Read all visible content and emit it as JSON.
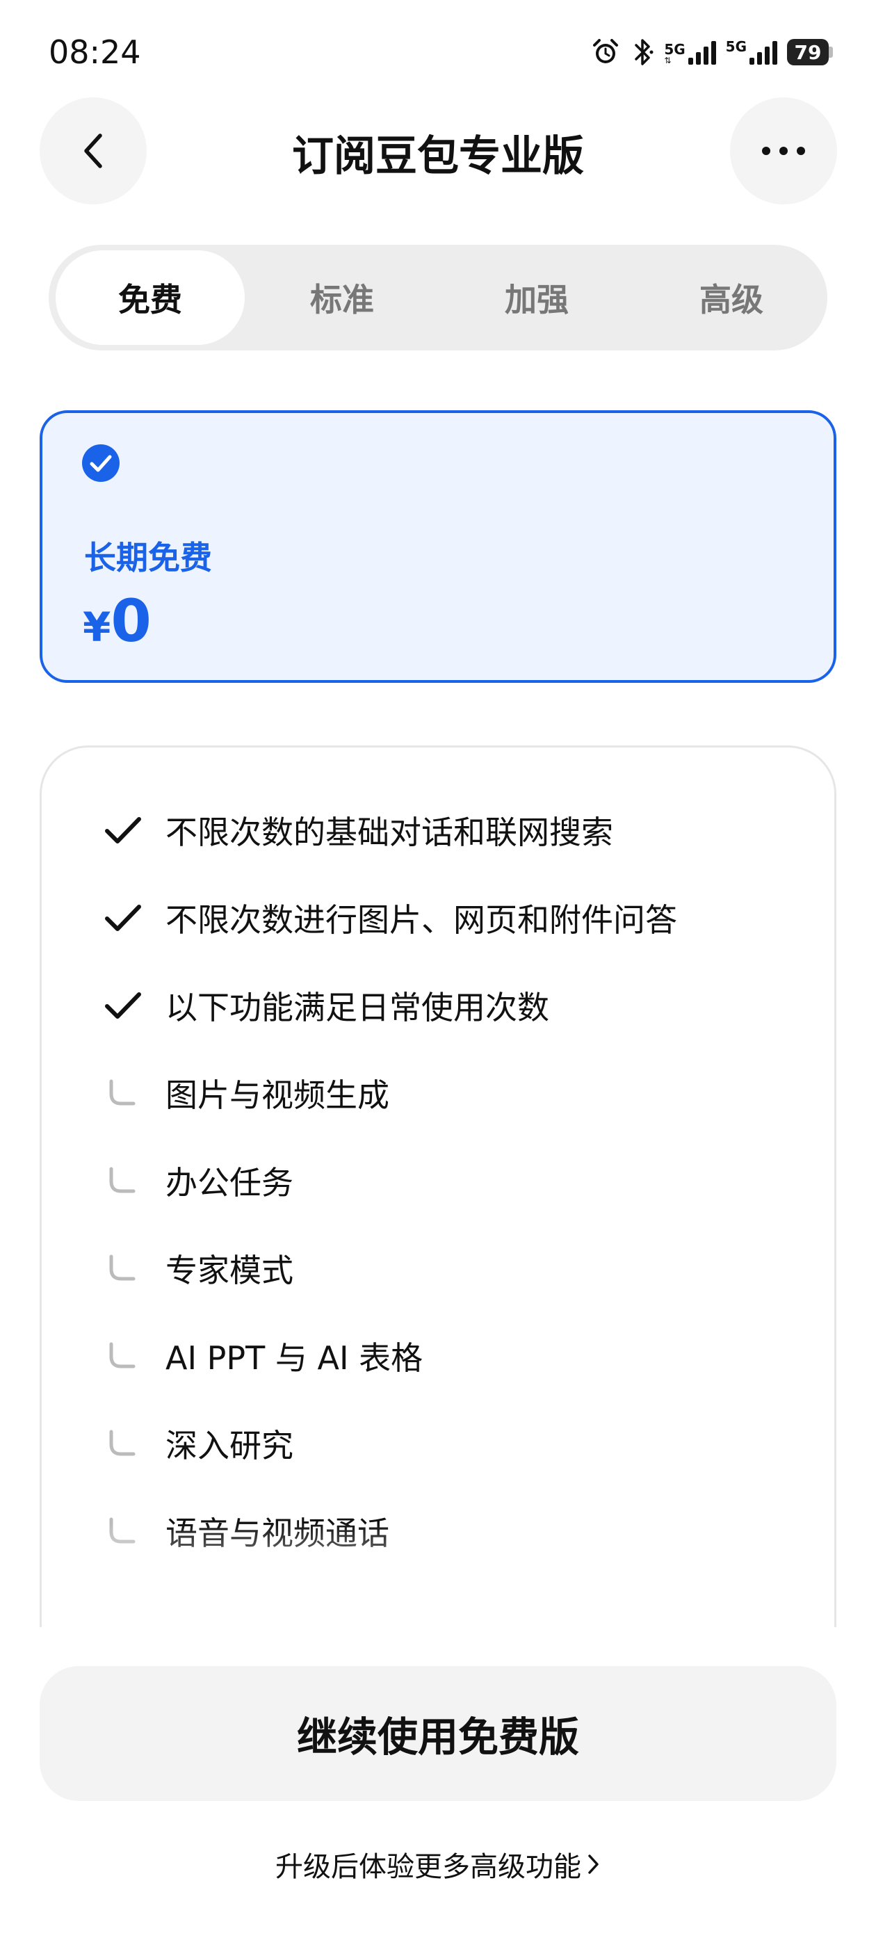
{
  "status_bar": {
    "time": "08:24",
    "network_1": "5G",
    "network_2": "5G",
    "battery": "79"
  },
  "header": {
    "title": "订阅豆包专业版"
  },
  "tabs": [
    {
      "label": "免费",
      "active": true
    },
    {
      "label": "标准",
      "active": false
    },
    {
      "label": "加强",
      "active": false
    },
    {
      "label": "高级",
      "active": false
    }
  ],
  "plan": {
    "name": "长期免费",
    "currency": "¥",
    "price": "0"
  },
  "features": [
    {
      "text": "不限次数的基础对话和联网搜索",
      "type": "check"
    },
    {
      "text": "不限次数进行图片、网页和附件问答",
      "type": "check"
    },
    {
      "text": "以下功能满足日常使用次数",
      "type": "check"
    },
    {
      "text": "图片与视频生成",
      "type": "sub"
    },
    {
      "text": "办公任务",
      "type": "sub"
    },
    {
      "text": "专家模式",
      "type": "sub"
    },
    {
      "text": "AI PPT 与 AI 表格",
      "type": "sub"
    },
    {
      "text": "深入研究",
      "type": "sub"
    },
    {
      "text": "语音与视频通话",
      "type": "sub"
    }
  ],
  "actions": {
    "continue_label": "继续使用免费版",
    "upgrade_label": "升级后体验更多高级功能"
  },
  "colors": {
    "accent": "#1a63e8",
    "card_bg": "#eef4ff",
    "tab_bg": "#ededed"
  }
}
